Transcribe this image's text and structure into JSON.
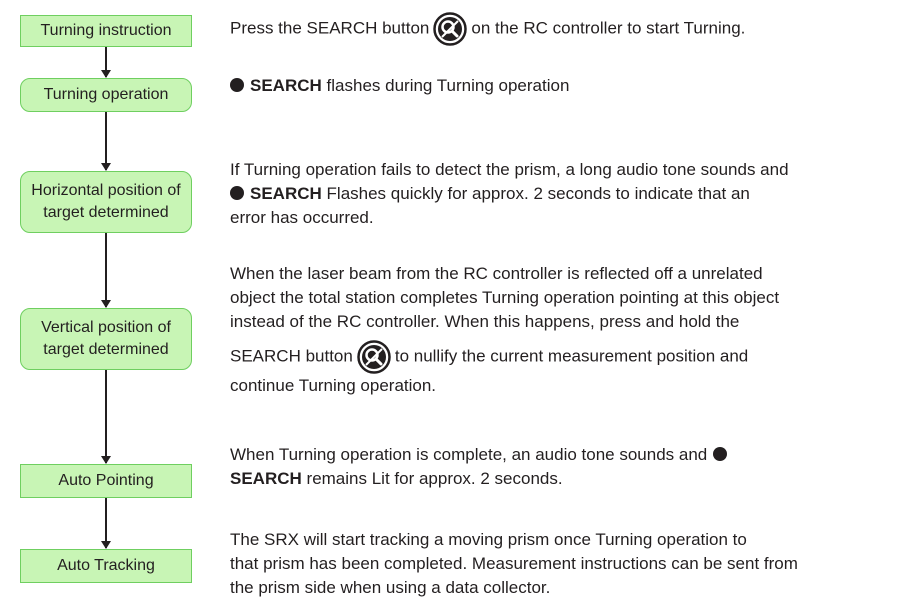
{
  "flow": {
    "steps": [
      "Turning instruction",
      "Turning operation",
      "Horizontal position of\ntarget determined",
      "Vertical position of\ntarget determined",
      "Auto Pointing",
      "Auto Tracking"
    ]
  },
  "para1": {
    "before": "Press the SEARCH button",
    "after": "on the RC controller to start Turning.",
    "icon": "search-button-icon"
  },
  "para2": {
    "bold": "SEARCH",
    "rest": "flashes during Turning operation"
  },
  "para3": {
    "line1": "If Turning operation fails to detect the prism, a long audio tone sounds and",
    "line2_bold": "SEARCH",
    "line2_rest": "Flashes quickly for approx. 2 seconds to indicate that an",
    "line3": "error has occurred."
  },
  "para4": {
    "line1": "When the laser beam from the RC controller is reflected off a unrelated",
    "line2": "object the total station completes Turning operation pointing at this object",
    "line3": "instead of the RC controller. When this happens, press and hold the",
    "line4_before": "SEARCH button",
    "line4_after": "to nullify the current measurement position and",
    "line5": "continue Turning operation.",
    "icon": "search-button-icon"
  },
  "para5": {
    "line1": "When Turning operation is complete, an audio tone sounds and",
    "line2_bold": "SEARCH",
    "line2_rest": "remains Lit for approx. 2 seconds."
  },
  "para6": {
    "line1": "The SRX will start tracking a moving prism once Turning operation to",
    "line2": "that prism has been completed. Measurement instructions can be sent from",
    "line3": "the prism side when using a data collector."
  },
  "colors": {
    "box_fill": "#c8f5b5",
    "box_border": "#6fcf60",
    "text": "#231f20"
  }
}
